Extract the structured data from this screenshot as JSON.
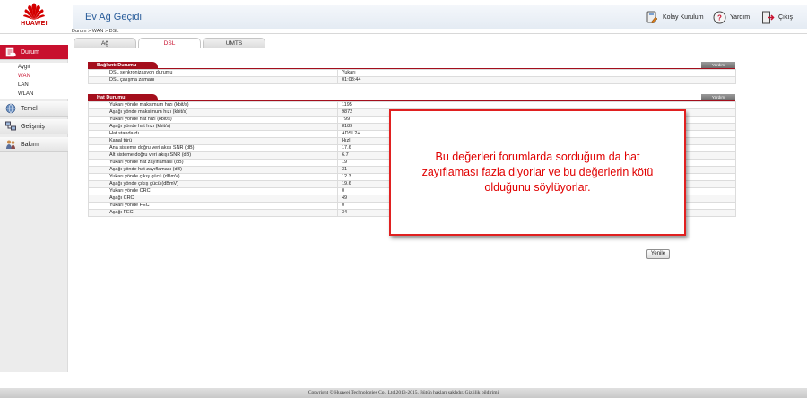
{
  "brand": {
    "logo_text": "HUAWEI",
    "color": "#c80000"
  },
  "header": {
    "title": "Ev Ağ Geçidi",
    "quick_setup": "Kolay Kurulum",
    "help": "Yardım",
    "logout": "Çıkış"
  },
  "breadcrumb": "Durum > WAN > DSL",
  "tabs": [
    {
      "label": "Ağ",
      "active": false
    },
    {
      "label": "DSL",
      "active": true
    },
    {
      "label": "UMTS",
      "active": false
    }
  ],
  "sidebar": {
    "status": {
      "label": "Durum",
      "icon": "status-icon",
      "active": true
    },
    "status_items": [
      {
        "label": "Aygıt",
        "active": false
      },
      {
        "label": "WAN",
        "active": true
      },
      {
        "label": "LAN",
        "active": false
      },
      {
        "label": "WLAN",
        "active": false
      }
    ],
    "basic": {
      "label": "Temel",
      "icon": "globe-icon"
    },
    "advanced": {
      "label": "Gelişmiş",
      "icon": "network-icon"
    },
    "maintenance": {
      "label": "Bakım",
      "icon": "people-icon"
    }
  },
  "connection": {
    "title": "Bağlantı Durumu",
    "help": "Yardım",
    "rows": [
      {
        "label": "DSL senkronizasyon durumu",
        "value": "Yukarı"
      },
      {
        "label": "DSL çalışma zamanı",
        "value": "01:08:44"
      }
    ]
  },
  "line": {
    "title": "Hat Durumu",
    "help": "Yardım",
    "rows": [
      {
        "label": "Yukarı yönde maksimum hızı (kbit/s)",
        "value": "1195"
      },
      {
        "label": "Aşağı yönde maksimum hızı (kbit/s)",
        "value": "9872"
      },
      {
        "label": "Yukarı yönde hat hızı (kbit/s)",
        "value": "799"
      },
      {
        "label": "Aşağı yönde hat hızı (kbit/s)",
        "value": "8189"
      },
      {
        "label": "Hat standardı",
        "value": "ADSL2+"
      },
      {
        "label": "Kanal türü",
        "value": "Hızlı"
      },
      {
        "label": "Ana sisteme doğru veri akışı SNR (dB)",
        "value": "17.6"
      },
      {
        "label": "Alt sisteme doğru veri akışı SNR (dB)",
        "value": "6.7"
      },
      {
        "label": "Yukarı yönde hat zayıflaması (dB)",
        "value": "19"
      },
      {
        "label": "Aşağı yönde hat zayıflaması (dB)",
        "value": "31"
      },
      {
        "label": "Yukarı yönde çıkış gücü (dBmV)",
        "value": "12.3"
      },
      {
        "label": "Aşağı yönde çıkış gücü (dBmV)",
        "value": "19.6"
      },
      {
        "label": "Yukarı yönde CRC",
        "value": "0"
      },
      {
        "label": "Aşağı CRC",
        "value": "49"
      },
      {
        "label": "Yukarı yönde FEC",
        "value": "0"
      },
      {
        "label": "Aşağı FEC",
        "value": "34"
      }
    ]
  },
  "refresh_label": "Yenile",
  "annotation": "Bu değerleri forumlarda sorduğum da hat zayıflaması fazla diyorlar ve bu değerlerin kötü olduğunu söylüyorlar.",
  "footer": "Copyright © Huawei Technologies Co., Ltd.2013-2015. Bütün hakları saklıdır. Gizlilik bildirimi"
}
